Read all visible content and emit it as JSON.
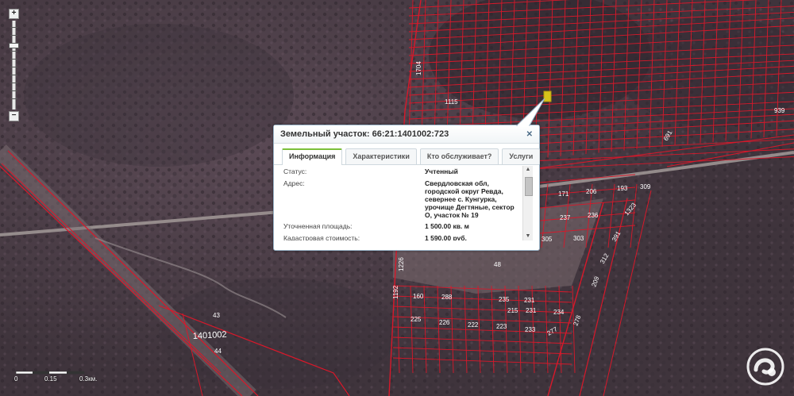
{
  "popup": {
    "title": "Земельный участок: 66:21:1401002:723",
    "close_icon": "close-icon",
    "tabs": [
      {
        "label": "Информация"
      },
      {
        "label": "Характеристики"
      },
      {
        "label": "Кто обслуживает?"
      },
      {
        "label": "Услуги"
      }
    ],
    "active_tab": "Информация",
    "rows": [
      {
        "label": "Статус:",
        "value": "Учтенный"
      },
      {
        "label": "Адрес:",
        "value": "Свердловская обл, городской округ Ревда, севернее с. Кунгурка, урочище Дегтяные, сектор О, участок № 19"
      },
      {
        "label": "Уточненная площадь:",
        "value": "1 500.00 кв. м"
      },
      {
        "label": "Кадастровая стоимость:",
        "value": "1 590.00 руб."
      }
    ]
  },
  "map": {
    "parcel_labels": [
      "1115",
      "1704",
      "171",
      "206",
      "193",
      "309",
      "237",
      "236",
      "1323",
      "305",
      "303",
      "391",
      "312",
      "209",
      "1226",
      "48",
      "1192",
      "160",
      "288",
      "235",
      "231",
      "234",
      "225",
      "226",
      "222",
      "223",
      "233",
      "277",
      "278",
      "691",
      "939",
      "215",
      "231",
      "43",
      "44"
    ],
    "quarter_label": "1401002",
    "colors": {
      "parcel_line": "#d8182a",
      "selected_parcel": "#d8c21a",
      "terrain": "#4a3d45"
    }
  },
  "zoom": {
    "plus": "+",
    "minus": "−"
  },
  "scale": {
    "labels": [
      "0",
      "0.15",
      "0.3км."
    ]
  },
  "icons": {
    "logo": "rosreestr-logo-icon",
    "zoom_in": "zoom-in-icon",
    "zoom_out": "zoom-out-icon"
  }
}
